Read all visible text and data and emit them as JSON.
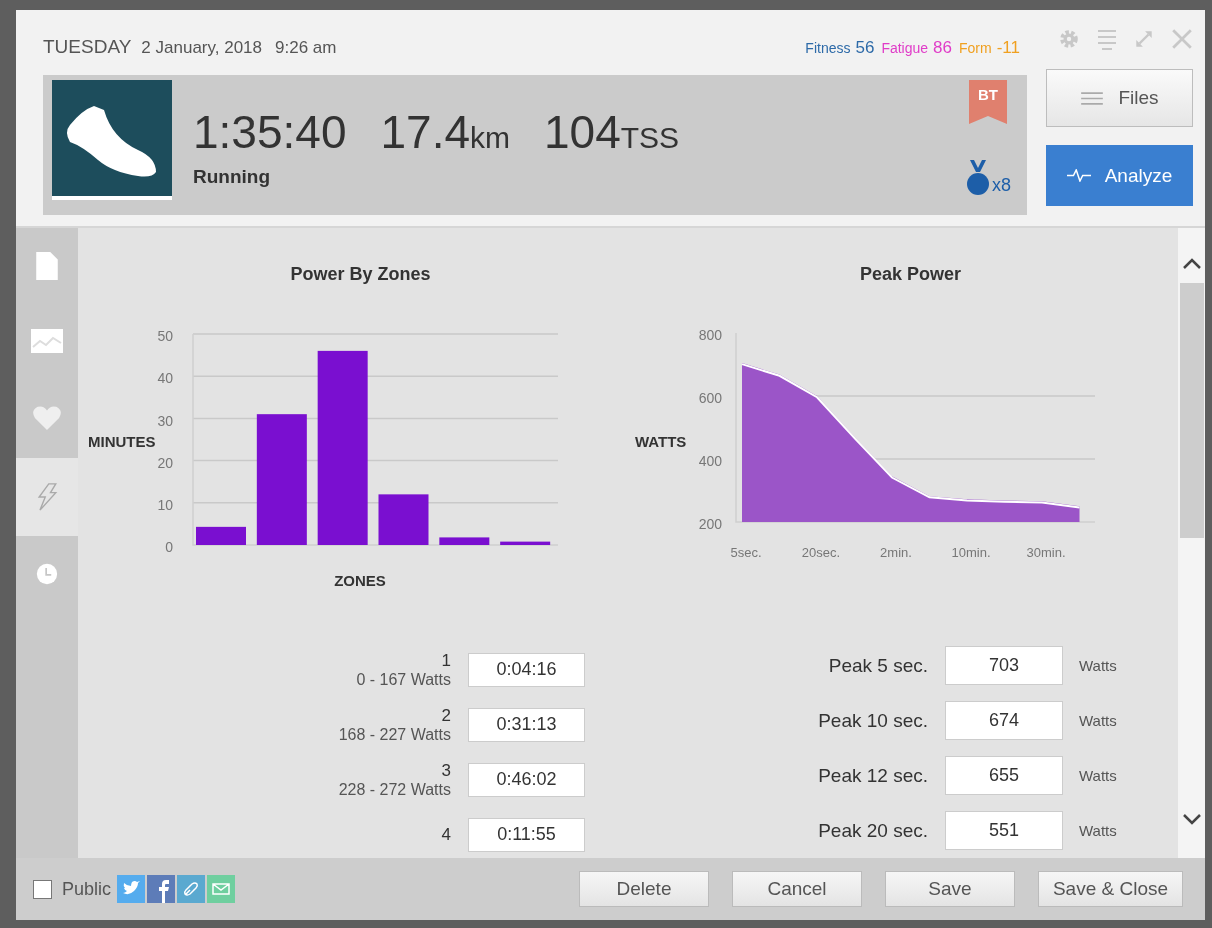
{
  "header": {
    "weekday": "TUESDAY",
    "date": "2 January, 2018",
    "time": "9:26 am",
    "metrics": [
      {
        "label": "Fitness",
        "value": "56",
        "color": "#2d6aa8"
      },
      {
        "label": "Fatigue",
        "value": "86",
        "color": "#e03cc8"
      },
      {
        "label": "Form",
        "value": "-11",
        "color": "#f0a020"
      }
    ]
  },
  "summary": {
    "duration": "1:35:40",
    "distance": "17.4",
    "distance_unit": "km",
    "tss": "104",
    "tss_unit": "TSS",
    "sport": "Running",
    "badge": "BT",
    "medal_count": "x8"
  },
  "actions": [
    {
      "label": "Files",
      "kind": "secondary"
    },
    {
      "label": "Analyze",
      "kind": "primary"
    }
  ],
  "sidebar": {
    "tabs": [
      {
        "kind": "document",
        "selected": false
      },
      {
        "kind": "chart",
        "selected": false
      },
      {
        "kind": "heart",
        "selected": false
      },
      {
        "kind": "power",
        "selected": true
      },
      {
        "kind": "clock",
        "selected": false
      }
    ]
  },
  "zones_chart": {
    "title": "Power By Zones",
    "chart_data": {
      "type": "bar",
      "xlabel": "ZONES",
      "ylabel": "MINUTES",
      "ylim": [
        0,
        50
      ],
      "yticks": [
        0,
        10,
        20,
        30,
        40,
        50
      ],
      "grid": true,
      "series": [
        {
          "color": "#7a0fd0",
          "values": [
            4.3,
            31,
            46,
            12,
            1.8,
            0.8
          ]
        }
      ]
    }
  },
  "peak_chart": {
    "title": "Peak Power",
    "chart_data": {
      "type": "area",
      "ylabel": "WATTS",
      "categories": [
        "5sec.",
        null,
        "20sec.",
        null,
        "2min.",
        null,
        "10min.",
        null,
        "30min.",
        null
      ],
      "ylim": [
        200,
        800
      ],
      "yticks": [
        200,
        400,
        600,
        800
      ],
      "grid": true,
      "series": [
        {
          "color": "#9b55c8",
          "values": [
            705,
            668,
            600,
            470,
            345,
            282,
            272,
            268,
            266,
            250
          ]
        }
      ]
    }
  },
  "zones": [
    {
      "number": "1",
      "range": "0 - 167 Watts",
      "time": "0:04:16"
    },
    {
      "number": "2",
      "range": "168 - 227 Watts",
      "time": "0:31:13"
    },
    {
      "number": "3",
      "range": "228 - 272 Watts",
      "time": "0:46:02"
    },
    {
      "number": "4",
      "time": "0:11:55"
    }
  ],
  "peaks": [
    {
      "label": "Peak 5 sec.",
      "value": "703",
      "unit": "Watts"
    },
    {
      "label": "Peak 10 sec.",
      "value": "674",
      "unit": "Watts"
    },
    {
      "label": "Peak 12 sec.",
      "value": "655",
      "unit": "Watts"
    },
    {
      "label": "Peak 20 sec.",
      "value": "551",
      "unit": "Watts"
    }
  ],
  "footer": {
    "public": {
      "label": "Public",
      "checked": false
    },
    "share": [
      {
        "kind": "twitter",
        "color": "#55acee"
      },
      {
        "kind": "facebook",
        "color": "#5d7cb8"
      },
      {
        "kind": "link",
        "color": "#5aa9d0"
      },
      {
        "kind": "mail",
        "color": "#6fcf9f"
      }
    ],
    "buttons": [
      "Delete",
      "Cancel",
      "Save",
      "Save & Close"
    ]
  }
}
